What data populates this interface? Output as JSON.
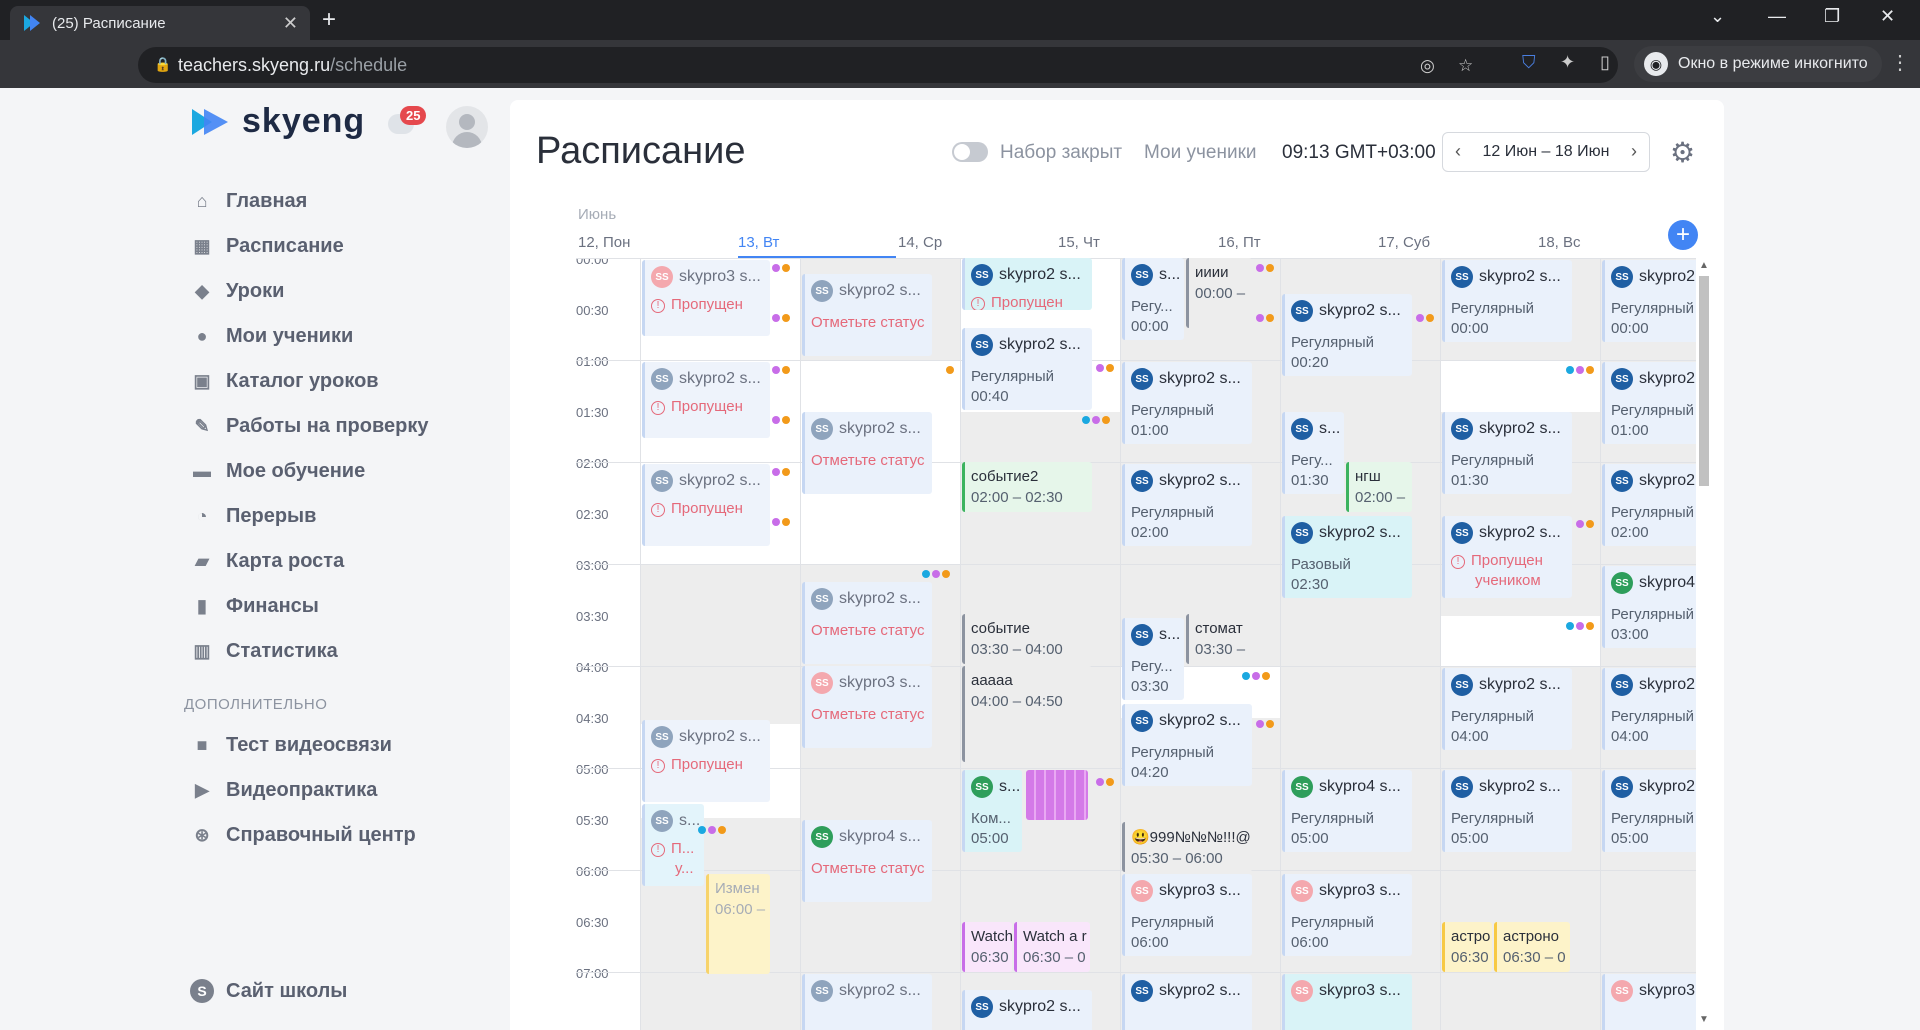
{
  "browser": {
    "tab_title": "(25) Расписание",
    "url_host": "teachers.skyeng.ru",
    "url_path": "/schedule",
    "incognito_label": "Окно в режиме инкогнито"
  },
  "sidebar": {
    "logo_text": "skyeng",
    "notification_count": "25",
    "items": [
      {
        "label": "Главная",
        "icon": "home-icon"
      },
      {
        "label": "Расписание",
        "icon": "calendar-icon"
      },
      {
        "label": "Уроки",
        "icon": "graduation-cap-icon"
      },
      {
        "label": "Мои ученики",
        "icon": "students-icon"
      },
      {
        "label": "Каталог уроков",
        "icon": "book-icon"
      },
      {
        "label": "Работы на проверку",
        "icon": "edit-icon"
      },
      {
        "label": "Мое обучение",
        "icon": "learning-icon"
      },
      {
        "label": "Перерыв",
        "icon": "clock-icon"
      },
      {
        "label": "Карта роста",
        "icon": "map-icon"
      },
      {
        "label": "Финансы",
        "icon": "wallet-icon"
      },
      {
        "label": "Статистика",
        "icon": "stats-icon"
      }
    ],
    "section_label": "ДОПОЛНИТЕЛЬНО",
    "extra_items": [
      {
        "label": "Тест видеосвязи",
        "icon": "video-icon"
      },
      {
        "label": "Видеопрактика",
        "icon": "play-icon"
      },
      {
        "label": "Справочный центр",
        "icon": "lifebuoy-icon"
      }
    ],
    "school_label": "Сайт школы",
    "school_icon_glyph": "S"
  },
  "header": {
    "title": "Расписание",
    "toggle_label": "Набор закрыт",
    "students_link": "Мои ученики",
    "time": "09:13 GMT+03:00",
    "date_range": "12 Июн – 18 Июн"
  },
  "calendar": {
    "month": "Июнь",
    "days": [
      "12, Пон",
      "13, Вт",
      "14, Ср",
      "15, Чт",
      "16, Пт",
      "17, Суб",
      "18, Вс"
    ],
    "times": [
      "00:00",
      "00:30",
      "01:00",
      "01:30",
      "02:00",
      "02:30",
      "03:00",
      "03:30",
      "04:00",
      "04:30",
      "05:00",
      "05:30",
      "06:00",
      "06:30",
      "07:00"
    ],
    "avatar_initials": "SS",
    "events": {
      "mon1": {
        "name": "skypro3 s...",
        "status": "Пропущен"
      },
      "mon2": {
        "name": "skypro2 s...",
        "status": "Пропущен"
      },
      "mon3": {
        "name": "skypro2 s...",
        "status": "Пропущен"
      },
      "mon4": {
        "name": "skypro2 s...",
        "status": "Пропущен"
      },
      "mon5": {
        "name": "s...",
        "status1": "П...",
        "status2": "у..."
      },
      "mon6": {
        "name": "Измен",
        "time": "06:00 –"
      },
      "tue1": {
        "name": "skypro2 s...",
        "status": "Отметьте статус"
      },
      "tue2": {
        "name": "skypro2 s...",
        "status": "Отметьте статус"
      },
      "tue3": {
        "name": "skypro2 s...",
        "status": "Отметьте статус"
      },
      "tue4": {
        "name": "skypro3 s...",
        "status": "Отметьте статус"
      },
      "tue5": {
        "name": "skypro4 s...",
        "status": "Отметьте статус"
      },
      "tue6": {
        "name": "skypro2 s..."
      },
      "wed1": {
        "name": "skypro2 s...",
        "status": "Пропущен"
      },
      "wed2": {
        "name": "skypro2 s...",
        "type": "Регулярный",
        "time": "00:40"
      },
      "wed3": {
        "name": "событие2",
        "time": "02:00 – 02:30"
      },
      "wed4": {
        "name": "событие",
        "time": "03:30 – 04:00"
      },
      "wed5": {
        "name": "ааааа",
        "time": "04:00 – 04:50"
      },
      "wed6": {
        "name": "s...",
        "type": "Ком...",
        "time": "05:00"
      },
      "wed7": {
        "name": "Watch",
        "time": "06:30"
      },
      "wed8": {
        "name": "Watch a r",
        "time": "06:30 – 0"
      },
      "wed9": {
        "name": "skypro2 s..."
      },
      "thu1": {
        "name": "s...",
        "type": "Регу...",
        "time": "00:00"
      },
      "thu2": {
        "name": "ииии",
        "time": "00:00 –"
      },
      "thu3": {
        "name": "skypro2 s...",
        "type": "Регулярный",
        "time": "01:00"
      },
      "thu4": {
        "name": "skypro2 s...",
        "type": "Регулярный",
        "time": "02:00"
      },
      "thu5": {
        "name": "s...",
        "type": "Регу...",
        "time": "03:30"
      },
      "thu6": {
        "name": "стомат",
        "time": "03:30 –"
      },
      "thu7": {
        "name": "skypro2 s...",
        "type": "Регулярный",
        "time": "04:20"
      },
      "thu8": {
        "name": "😃999№№№!!!@",
        "time": "05:30 – 06:00"
      },
      "thu9": {
        "name": "skypro3 s...",
        "type": "Регулярный",
        "time": "06:00"
      },
      "thu10": {
        "name": "skypro2 s..."
      },
      "fri1": {
        "name": "skypro2 s...",
        "type": "Регулярный",
        "time": "00:20"
      },
      "fri2": {
        "name": "s...",
        "type": "Регу...",
        "time": "01:30"
      },
      "fri3": {
        "name": "нгш",
        "time": "02:00 –"
      },
      "fri4": {
        "name": "skypro2 s...",
        "type": "Разовый",
        "time": "02:30"
      },
      "fri5": {
        "name": "skypro4 s...",
        "type": "Регулярный",
        "time": "05:00"
      },
      "fri6": {
        "name": "skypro3 s...",
        "type": "Регулярный",
        "time": "06:00"
      },
      "fri7": {
        "name": "skypro3 s..."
      },
      "sat1": {
        "name": "skypro2 s...",
        "type": "Регулярный",
        "time": "00:00"
      },
      "sat2": {
        "name": "skypro2 s...",
        "type": "Регулярный",
        "time": "01:30"
      },
      "sat3": {
        "name": "skypro2 s...",
        "status1": "Пропущен",
        "status2": "учеником"
      },
      "sat4": {
        "name": "skypro2 s...",
        "type": "Регулярный",
        "time": "04:00"
      },
      "sat5": {
        "name": "skypro2 s...",
        "type": "Регулярный",
        "time": "05:00"
      },
      "sat6": {
        "name": "астро",
        "time": "06:30"
      },
      "sat7": {
        "name": "астроно",
        "time": "06:30 – 0"
      },
      "sun1": {
        "name": "skypro2 s...",
        "type": "Регулярный",
        "time": "00:00"
      },
      "sun2": {
        "name": "skypro2 s...",
        "type": "Регулярный",
        "time": "01:00"
      },
      "sun3": {
        "name": "skypro2 s...",
        "type": "Регулярный",
        "time": "02:00"
      },
      "sun4": {
        "name": "skypro4 s...",
        "type": "Регулярный",
        "time": "03:00"
      },
      "sun5": {
        "name": "skypro2 s...",
        "type": "Регулярный",
        "time": "04:00"
      },
      "sun6": {
        "name": "skypro2 s...",
        "type": "Регулярный",
        "time": "05:00"
      },
      "sun7": {
        "name": "skypro3 s..."
      }
    }
  },
  "colors": {
    "accent": "#4285f4",
    "missed": "#e5697a",
    "brand_dark": "#1e2a44"
  }
}
